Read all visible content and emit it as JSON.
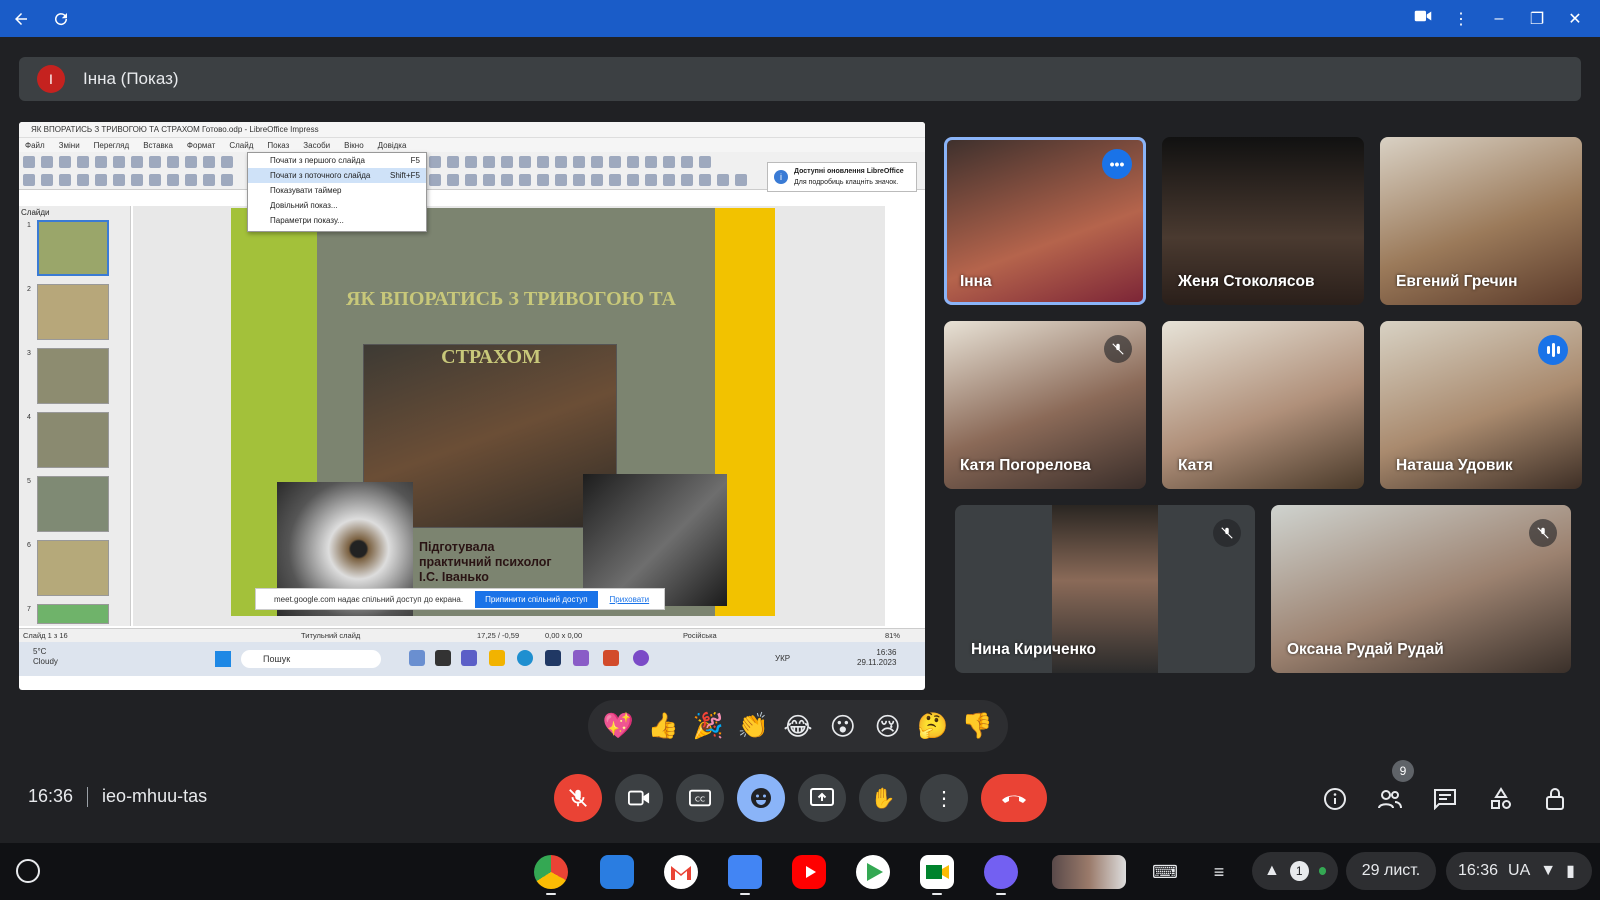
{
  "window": {
    "controls": [
      "back-icon",
      "refresh-icon",
      "camera-icon",
      "more-vert-icon",
      "minimize-icon",
      "restore-icon",
      "close-icon"
    ]
  },
  "presenter": {
    "avatar_letter": "І",
    "label": "Інна (Показ)"
  },
  "shared_screen": {
    "window_title": "ЯК ВПОРАТИСЬ З ТРИВОГОЮ ТА СТРАХОМ Готово.odp - LibreOffice Impress",
    "menu": [
      "Файл",
      "Зміни",
      "Перегляд",
      "Вставка",
      "Формат",
      "Слайд",
      "Показ",
      "Засоби",
      "Вікно",
      "Довідка"
    ],
    "dropdown": [
      {
        "label": "Почати з першого слайда",
        "key": "F5"
      },
      {
        "label": "Почати з поточного слайда",
        "key": "Shift+F5"
      },
      {
        "label": "Показувати таймер",
        "key": ""
      },
      {
        "label": "Довільний показ...",
        "key": ""
      },
      {
        "label": "Параметри показу...",
        "key": ""
      }
    ],
    "update_notice": {
      "title": "Доступні оновлення LibreOffice",
      "subtitle": "Для подробиць клацніть значок."
    },
    "slides_panel_title": "Слайди",
    "slide_numbers": [
      "1",
      "2",
      "3",
      "4",
      "5",
      "6",
      "7"
    ],
    "slide": {
      "title_line1": "ЯК ВПОРАТИСЬ З ТРИВОГОЮ ТА",
      "title_line2": "СТРАХОМ",
      "credit_line1": "Підготувала",
      "credit_line2": "практичний психолог",
      "credit_line3": "І.С. Іванько"
    },
    "share_bar": {
      "text": "meet.google.com надає спільний доступ до екрана.",
      "stop_button": "Припинити спільний доступ",
      "hide_link": "Приховати"
    },
    "status": {
      "slide": "Слайд 1 з 16",
      "layout": "Титульний слайд",
      "position": "17,25 / -0,59",
      "size": "0,00 x 0,00",
      "language": "Російська",
      "zoom": "81%"
    },
    "taskbar": {
      "temp": "5°C",
      "weather": "Cloudy",
      "search": "Пошук",
      "lang": "УКР",
      "time": "16:36",
      "date": "29.11.2023"
    }
  },
  "participants": [
    {
      "name": "Інна",
      "state": "active"
    },
    {
      "name": "Женя Стоколясов",
      "state": "none"
    },
    {
      "name": "Евгений Гречин",
      "state": "none"
    },
    {
      "name": "Катя Погорелова",
      "state": "muted"
    },
    {
      "name": "Катя",
      "state": "none"
    },
    {
      "name": "Наташа Удовик",
      "state": "speaking"
    },
    {
      "name": "Нина Кириченко",
      "state": "muted"
    },
    {
      "name": "Оксана Рудай Рудай",
      "state": "muted"
    }
  ],
  "reactions": [
    "💖",
    "👍",
    "🎉",
    "👏",
    "😂",
    "😮",
    "😢",
    "🤔",
    "👎"
  ],
  "meeting": {
    "time": "16:36",
    "code": "ieo-mhuu-tas",
    "people_count": "9"
  },
  "controls": [
    "mic-off-icon",
    "camera-icon",
    "captions-icon",
    "emoji-icon",
    "present-icon",
    "raise-hand-icon",
    "more-vert-icon",
    "end-call-icon"
  ],
  "right_controls": [
    "info-icon",
    "people-icon",
    "chat-icon",
    "activities-icon",
    "host-controls-icon"
  ],
  "shelf": {
    "apps": [
      "chrome",
      "files",
      "gmail",
      "docs",
      "youtube",
      "play-store",
      "meet",
      "viber"
    ],
    "notification_count": "1",
    "date": "29 лист.",
    "time": "16:36",
    "region": "UA"
  },
  "colors": {
    "titlebar": "#1a5cc8",
    "background": "#202124",
    "end_call": "#ea4335",
    "accent": "#8ab4f8"
  }
}
